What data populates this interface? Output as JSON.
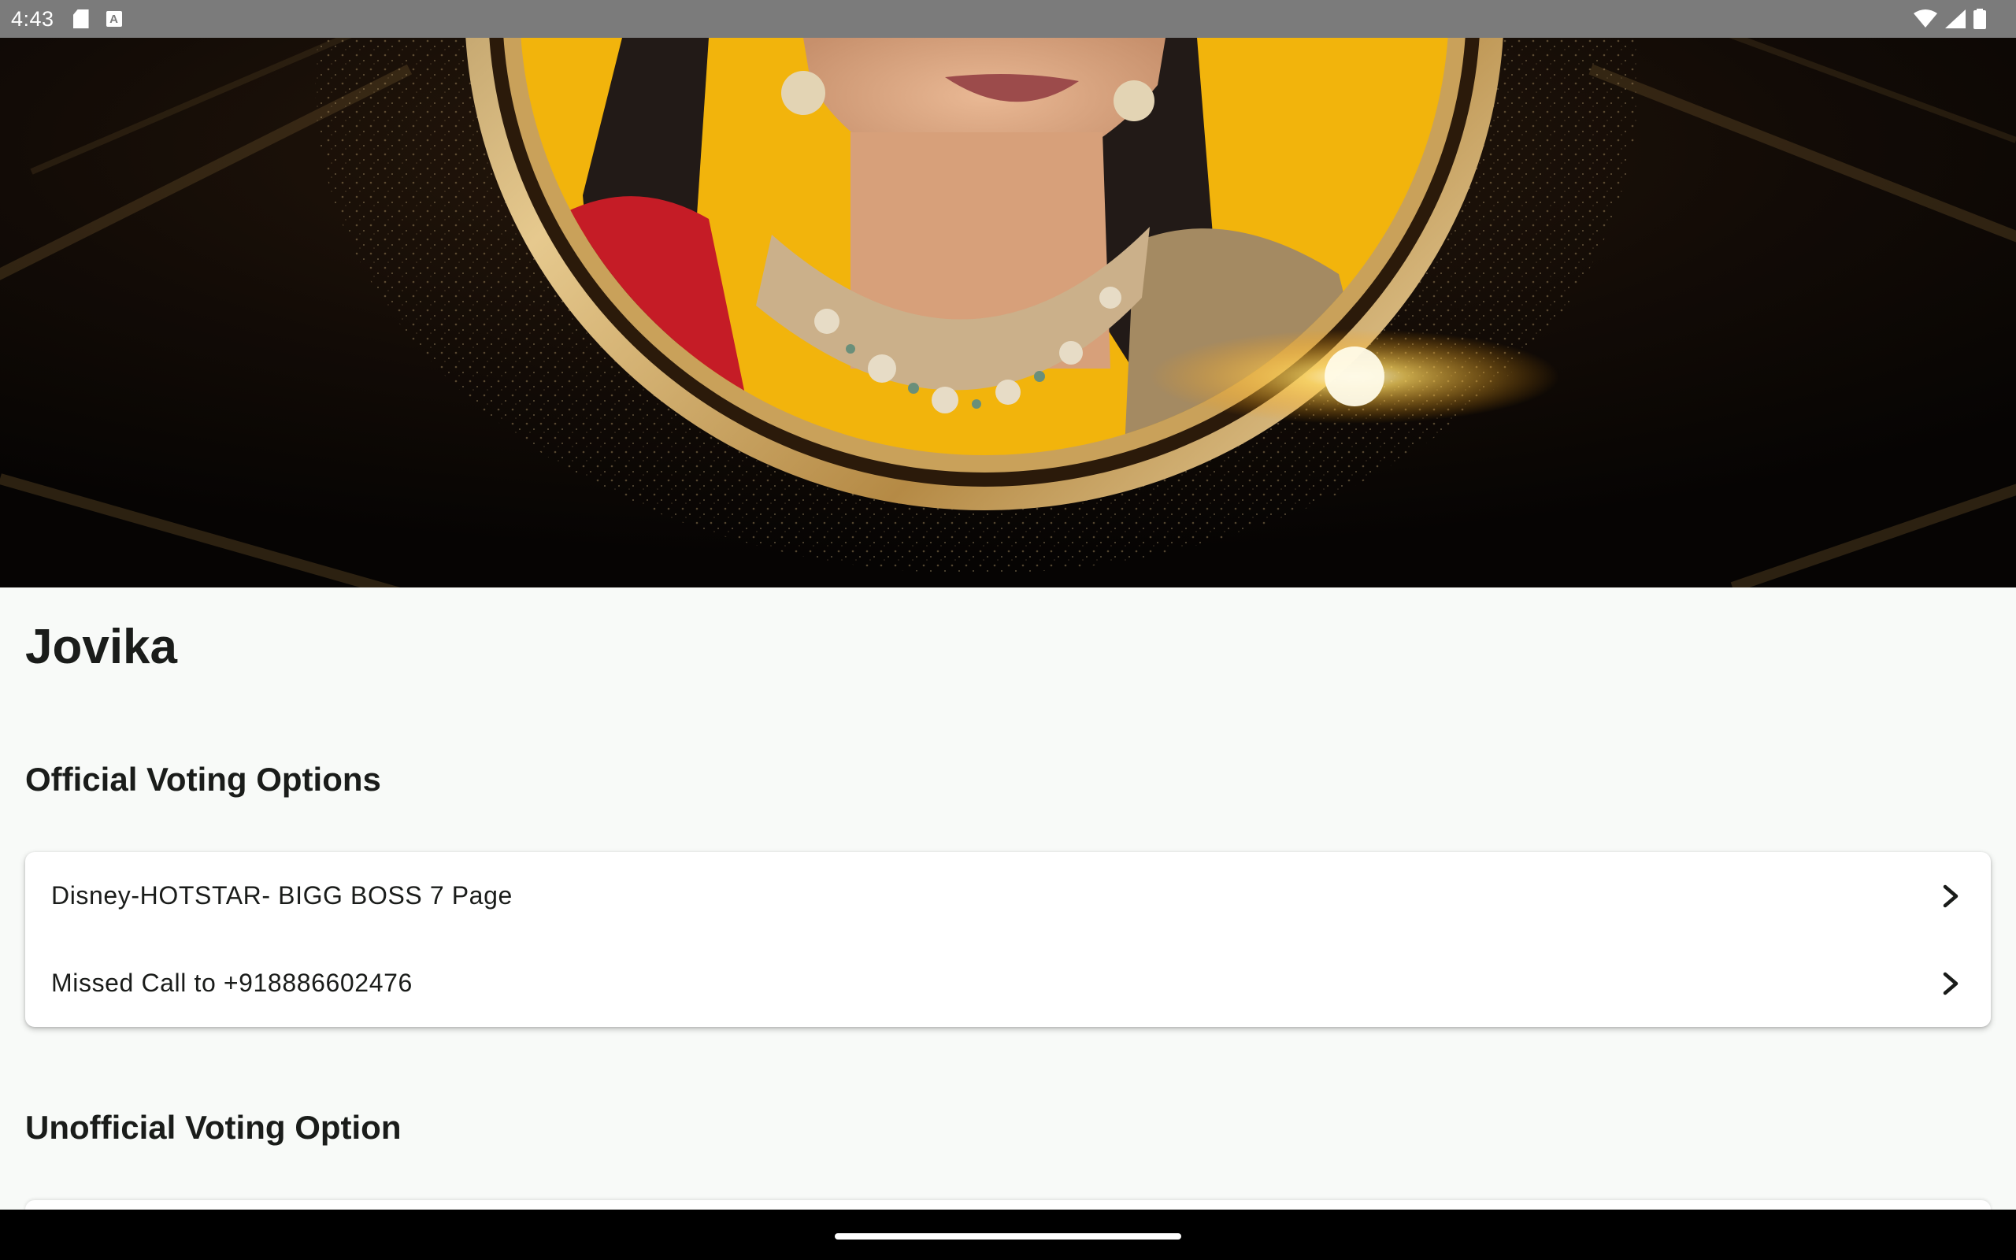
{
  "status_bar": {
    "time": "4:43",
    "left_icons": [
      "sd-card-icon",
      "keyboard-a-icon"
    ],
    "right_icons": [
      "wifi-icon",
      "signal-icon",
      "battery-icon"
    ]
  },
  "hero": {
    "image": "contestant-portrait",
    "colors": {
      "background": "#0b0704",
      "portrait_bg": "#f2b40c",
      "ring": "#c9a15a"
    }
  },
  "contestant": {
    "name": "Jovika"
  },
  "official": {
    "title": "Official Voting Options",
    "options": [
      {
        "label": "Disney-HOTSTAR- BIGG BOSS 7 Page",
        "icon": "chevron-right-icon"
      },
      {
        "label": "Missed Call to +918886602476",
        "icon": "chevron-right-icon"
      }
    ]
  },
  "unofficial": {
    "title": "Unofficial Voting Option"
  },
  "colors": {
    "page_bg": "#f8faf8",
    "text": "#1a1c1a",
    "status_bar": "#7b7b7b",
    "nav_bar": "#000000"
  }
}
